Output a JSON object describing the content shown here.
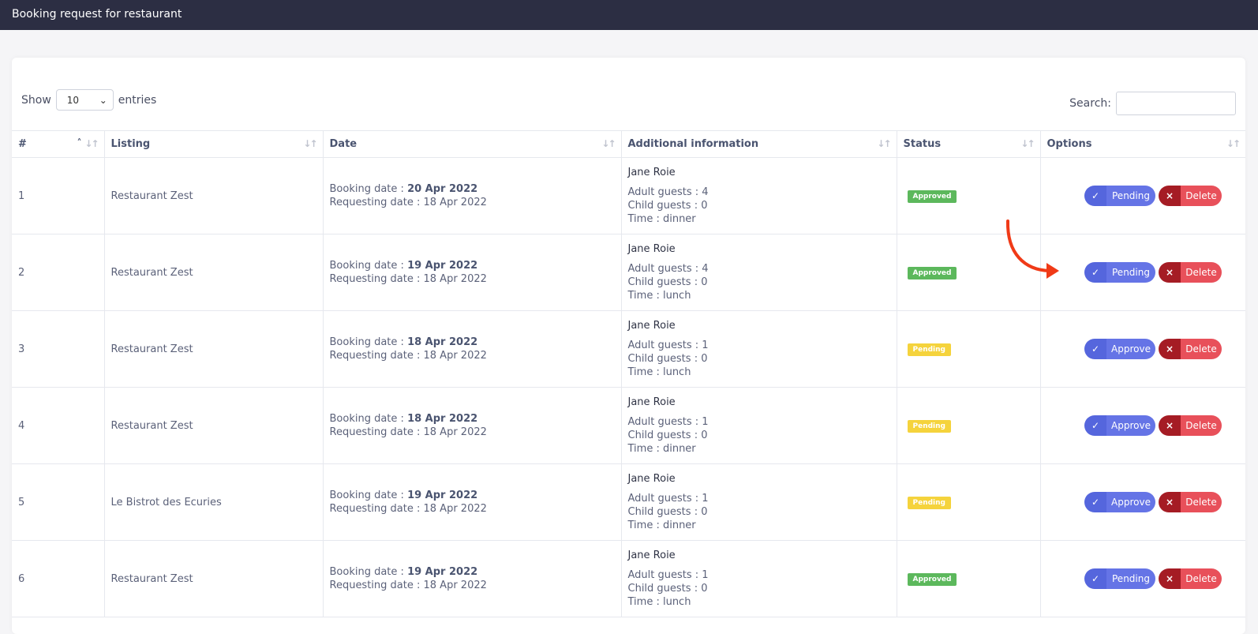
{
  "header": {
    "title": "Booking request for restaurant"
  },
  "controls": {
    "show_label": "Show",
    "entries_value": "10",
    "entries_label": "entries",
    "search_label": "Search:"
  },
  "columns": [
    "#",
    "Listing",
    "Date",
    "Additional information",
    "Status",
    "Options"
  ],
  "labels": {
    "booking_date": "Booking date : ",
    "requesting_date": "Requesting date : ",
    "adult": "Adult guests : ",
    "child": "Child guests : ",
    "time": "Time : ",
    "delete": "Delete"
  },
  "colors": {
    "approved": "#5cb85c",
    "pending": "#f5d33c"
  },
  "rows": [
    {
      "id": "1",
      "listing": "Restaurant Zest",
      "booking_date": "20 Apr 2022",
      "requesting_date": "18 Apr 2022",
      "name": "Jane Roie",
      "adult": "4",
      "child": "0",
      "time": "dinner",
      "status": "Approved",
      "action": "Pending"
    },
    {
      "id": "2",
      "listing": "Restaurant Zest",
      "booking_date": "19 Apr 2022",
      "requesting_date": "18 Apr 2022",
      "name": "Jane Roie",
      "adult": "4",
      "child": "0",
      "time": "lunch",
      "status": "Approved",
      "action": "Pending"
    },
    {
      "id": "3",
      "listing": "Restaurant Zest",
      "booking_date": "18 Apr 2022",
      "requesting_date": "18 Apr 2022",
      "name": "Jane Roie",
      "adult": "1",
      "child": "0",
      "time": "lunch",
      "status": "Pending",
      "action": "Approve"
    },
    {
      "id": "4",
      "listing": "Restaurant Zest",
      "booking_date": "18 Apr 2022",
      "requesting_date": "18 Apr 2022",
      "name": "Jane Roie",
      "adult": "1",
      "child": "0",
      "time": "dinner",
      "status": "Pending",
      "action": "Approve"
    },
    {
      "id": "5",
      "listing": "Le Bistrot des Ecuries",
      "booking_date": "19 Apr 2022",
      "requesting_date": "18 Apr 2022",
      "name": "Jane Roie",
      "adult": "1",
      "child": "0",
      "time": "dinner",
      "status": "Pending",
      "action": "Approve"
    },
    {
      "id": "6",
      "listing": "Restaurant Zest",
      "booking_date": "19 Apr 2022",
      "requesting_date": "18 Apr 2022",
      "name": "Jane Roie",
      "adult": "1",
      "child": "0",
      "time": "lunch",
      "status": "Approved",
      "action": "Pending"
    }
  ]
}
